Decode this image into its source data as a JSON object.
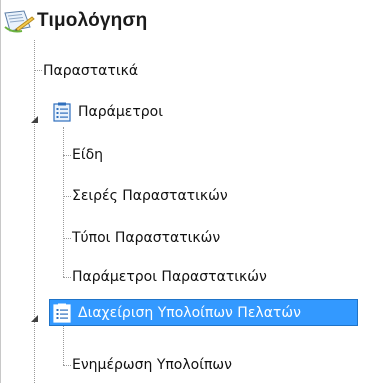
{
  "header": {
    "title": "Τιμολόγηση",
    "icon": "document-pen-icon"
  },
  "tree": {
    "items": [
      {
        "label": "Παραστατικά",
        "icon": null
      },
      {
        "label": "Παράμετροι",
        "icon": "list-document-icon",
        "expanded": true
      },
      {
        "label": "Είδη",
        "icon": null
      },
      {
        "label": "Σειρές Παραστατικών",
        "icon": null
      },
      {
        "label": "Τύποι Παραστατικών",
        "icon": null
      },
      {
        "label": "Παράμετροι Παραστατικών",
        "icon": null
      },
      {
        "label": "Διαχείριση Υπολοίπων Πελατών",
        "icon": "list-document-icon",
        "expanded": true,
        "selected": true
      },
      {
        "label": "Ενημέρωση Υπολοίπων",
        "icon": null
      }
    ]
  },
  "colors": {
    "selection": "#3399ff",
    "selection_border": "#1e73c8",
    "tree_lines": "#9a9a9a"
  }
}
